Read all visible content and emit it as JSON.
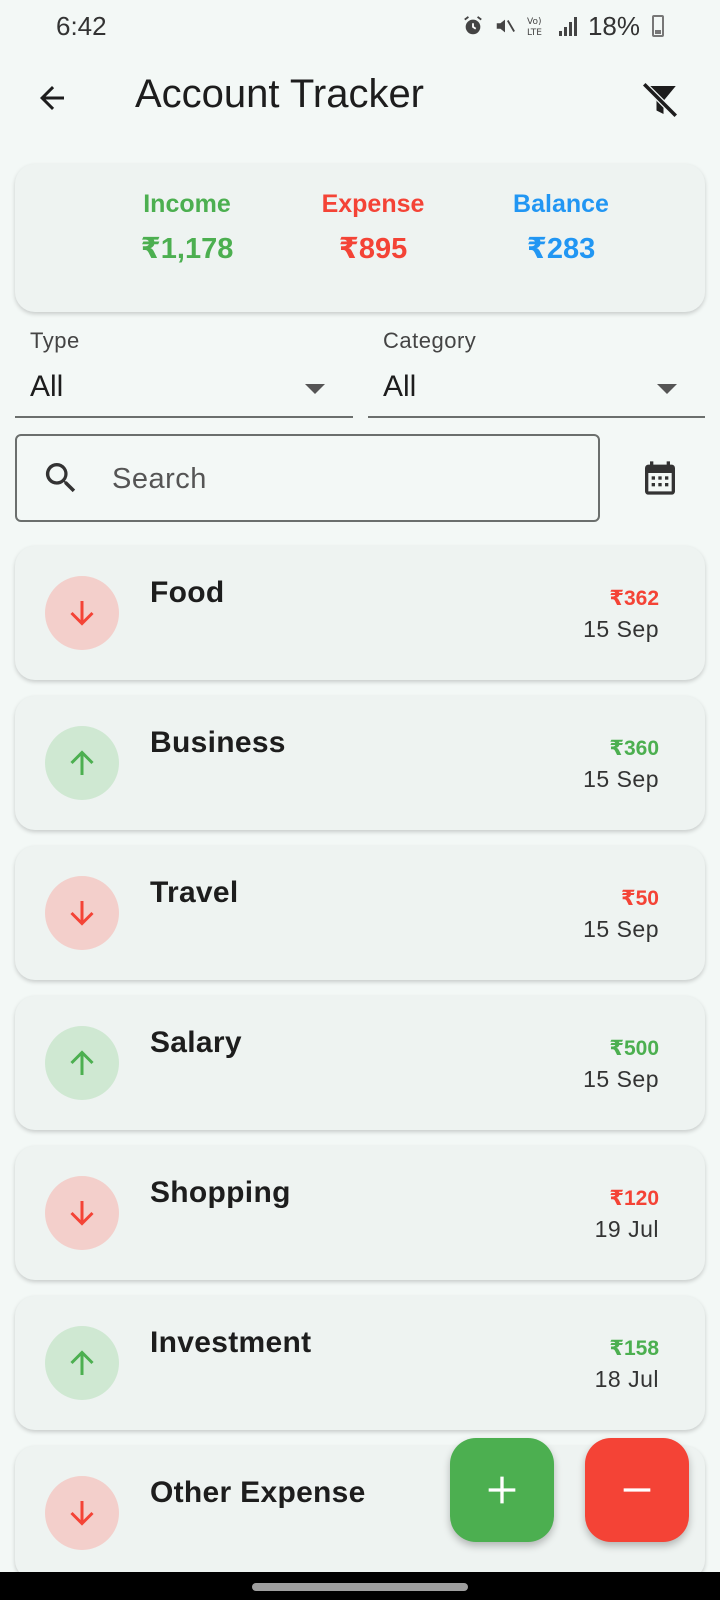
{
  "status_bar": {
    "time": "6:42",
    "battery": "18%"
  },
  "app_bar": {
    "title": "Account Tracker"
  },
  "summary": {
    "income_label": "Income",
    "income_value": "₹1,178",
    "expense_label": "Expense",
    "expense_value": "₹895",
    "balance_label": "Balance",
    "balance_value": "₹283"
  },
  "filters": {
    "type_label": "Type",
    "type_value": "All",
    "category_label": "Category",
    "category_value": "All"
  },
  "search": {
    "placeholder": "Search",
    "value": ""
  },
  "transactions": [
    {
      "name": "Food",
      "amount": "₹362",
      "date": "15 Sep",
      "kind": "expense"
    },
    {
      "name": "Business",
      "amount": "₹360",
      "date": "15 Sep",
      "kind": "income"
    },
    {
      "name": "Travel",
      "amount": "₹50",
      "date": "15 Sep",
      "kind": "expense"
    },
    {
      "name": "Salary",
      "amount": "₹500",
      "date": "15 Sep",
      "kind": "income"
    },
    {
      "name": "Shopping",
      "amount": "₹120",
      "date": "19 Jul",
      "kind": "expense"
    },
    {
      "name": "Investment",
      "amount": "₹158",
      "date": "18 Jul",
      "kind": "income"
    },
    {
      "name": "Other Expense",
      "amount": "",
      "date": "",
      "kind": "expense"
    }
  ],
  "colors": {
    "income": "#4caf50",
    "expense": "#f44336",
    "balance": "#2196f3"
  },
  "icons": {
    "back": "arrow-back-icon",
    "filter_off": "filter-off-icon",
    "search": "search-icon",
    "calendar": "calendar-icon",
    "expense": "arrow-down-icon",
    "income": "arrow-up-icon",
    "add": "plus-icon",
    "subtract": "minus-icon"
  }
}
